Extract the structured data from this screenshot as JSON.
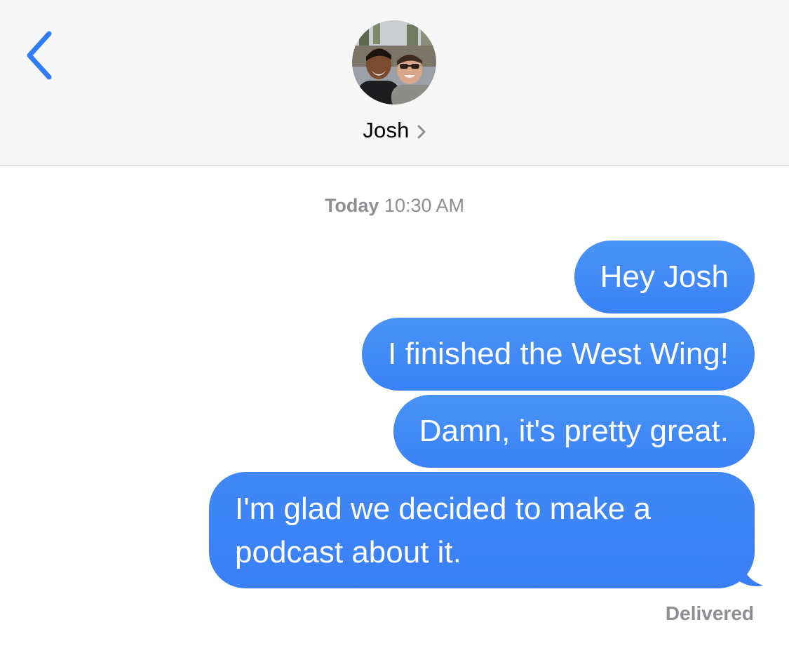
{
  "header": {
    "contact_name": "Josh",
    "avatar_description": "contact-photo"
  },
  "thread": {
    "timestamp_day": "Today",
    "timestamp_time": "10:30 AM",
    "messages": [
      {
        "text": "Hey Josh",
        "direction": "outgoing"
      },
      {
        "text": "I finished the West Wing!",
        "direction": "outgoing"
      },
      {
        "text": "Damn, it's pretty great.",
        "direction": "outgoing"
      },
      {
        "text_line1": "I'm glad we decided to make a",
        "text_line2": "podcast about it.",
        "direction": "outgoing"
      }
    ],
    "status": "Delivered"
  },
  "colors": {
    "bubble": "#3b82f6",
    "accent": "#2f7cf6",
    "meta_text": "#8e8e93",
    "header_bg": "#f7f7f7"
  },
  "icons": {
    "back": "chevron-left-icon",
    "name_disclosure": "chevron-right-icon"
  }
}
